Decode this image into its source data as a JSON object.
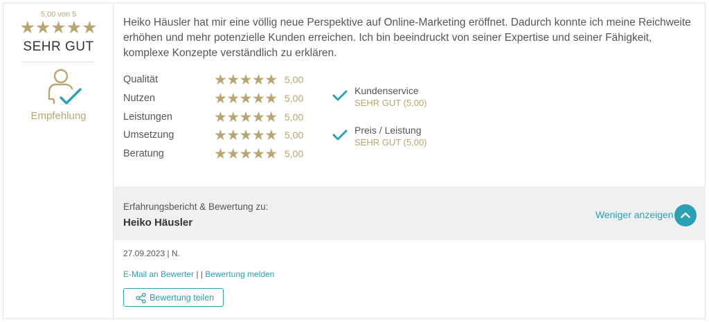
{
  "summary": {
    "score_text": "5,00 von 5",
    "stars": "★★★★★",
    "grade": "SEHR GUT",
    "recommendation_label": "Empfehlung"
  },
  "review": {
    "text": "Heiko Häusler hat mir eine völlig neue Perspektive auf Online-Marketing eröffnet. Dadurch konnte ich meine Reichweite erhöhen und mehr potenzielle Kunden erreichen. Ich bin beeindruckt von seiner Expertise und seiner Fähigkeit, komplexe Konzepte verständlich zu erklären."
  },
  "ratings": [
    {
      "label": "Qualität",
      "stars": "★★★★★",
      "value": "5,00"
    },
    {
      "label": "Nutzen",
      "stars": "★★★★★",
      "value": "5,00"
    },
    {
      "label": "Leistungen",
      "stars": "★★★★★",
      "value": "5,00"
    },
    {
      "label": "Umsetzung",
      "stars": "★★★★★",
      "value": "5,00"
    },
    {
      "label": "Beratung",
      "stars": "★★★★★",
      "value": "5,00"
    }
  ],
  "checks": [
    {
      "title": "Kundenservice",
      "sub": "SEHR GUT (5,00)"
    },
    {
      "title": "Preis / Leistung",
      "sub": "SEHR GUT (5,00)"
    }
  ],
  "band": {
    "label": "Erfahrungsbericht & Bewertung zu:",
    "name": "Heiko Häusler",
    "less_link": "Weniger anzeigen"
  },
  "meta": {
    "date_author": "27.09.2023 | N.",
    "email_link": "E-Mail an Bewerter",
    "separator": " | | ",
    "report_link": "Bewertung melden",
    "share_label": "Bewertung teilen"
  },
  "colors": {
    "gold": "#b8a570",
    "teal": "#2aa0b4",
    "band": "#eef0f1"
  },
  "icons": {
    "recommendation": "person-check-icon",
    "check": "checkmark-icon",
    "chevron": "chevron-up-icon",
    "share": "share-icon"
  }
}
